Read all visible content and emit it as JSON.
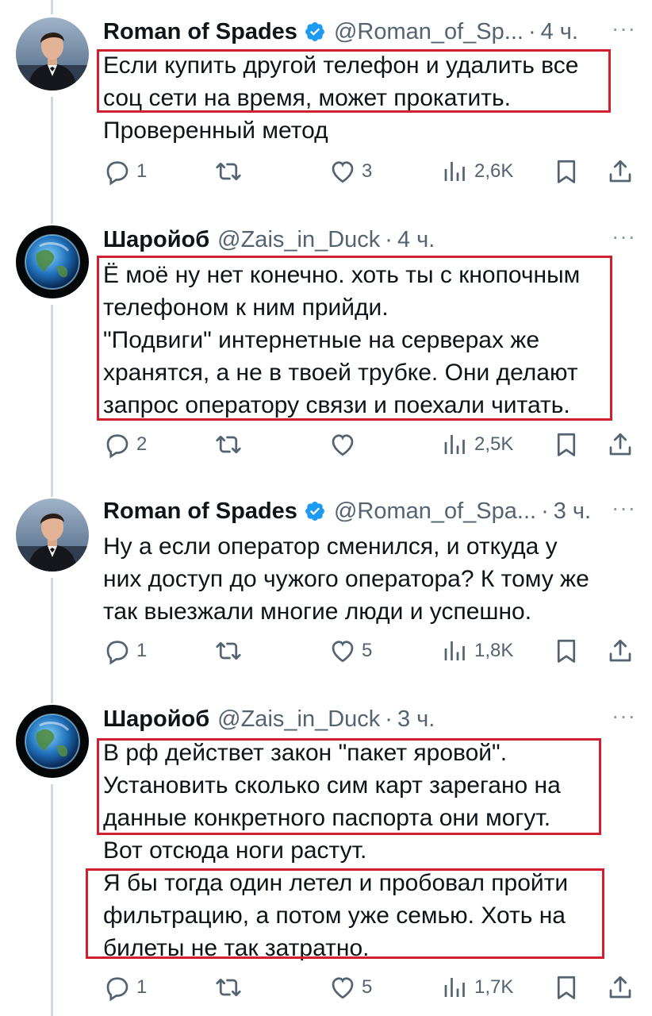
{
  "colors": {
    "accent": "#1d9bf0",
    "highlight": "#d1202f",
    "muted": "#536471"
  },
  "tweets": [
    {
      "name": "Roman of Spades",
      "verified": true,
      "handle": "@Roman_of_Sp...",
      "time": "4 ч.",
      "lines": [
        "Если купить другой телефон и удалить все",
        "соц сети на время, может прокатить.",
        "Проверенный метод"
      ],
      "stats": {
        "replies": "1",
        "retweets": "",
        "likes": "3",
        "views": "2,6K"
      }
    },
    {
      "name": "Шаройоб",
      "verified": false,
      "handle": "@Zais_in_Duck",
      "time": "4 ч.",
      "lines": [
        "Ё моё ну нет конечно. хоть ты с кнопочным",
        "телефоном к ним прийди.",
        "\"Подвиги\" интернетные на серверах же",
        "хранятся, а не в твоей трубке. Они делают",
        "запрос оператору связи и поехали читать."
      ],
      "stats": {
        "replies": "2",
        "retweets": "",
        "likes": "",
        "views": "2,5K"
      }
    },
    {
      "name": "Roman of Spades",
      "verified": true,
      "handle": "@Roman_of_Spa...",
      "time": "3 ч.",
      "lines": [
        "Ну а если оператор сменился, и откуда у",
        "них доступ до чужого оператора? К тому же",
        "так выезжали многие люди и успешно."
      ],
      "stats": {
        "replies": "1",
        "retweets": "",
        "likes": "5",
        "views": "1,8K"
      }
    },
    {
      "name": "Шаройоб",
      "verified": false,
      "handle": "@Zais_in_Duck",
      "time": "3 ч.",
      "lines": [
        "В рф действет закон \"пакет яровой\".",
        "Установить сколько сим карт зарегано на",
        "данные конкретного паспорта они могут.",
        "Вот отсюда ноги растут.",
        "Я бы тогда один летел и пробовал пройти",
        "фильтрацию, а потом уже семью. Хоть на",
        "билеты не так затратно."
      ],
      "stats": {
        "replies": "1",
        "retweets": "",
        "likes": "5",
        "views": "1,7K"
      }
    }
  ],
  "icons": {
    "reply": "reply-icon",
    "retweet": "retweet-icon",
    "like": "heart-icon",
    "views": "views-icon",
    "bookmark": "bookmark-icon",
    "share": "share-icon",
    "more": "more-icon",
    "verified": "verified-badge-icon"
  },
  "more_label": "···",
  "separator": "·"
}
